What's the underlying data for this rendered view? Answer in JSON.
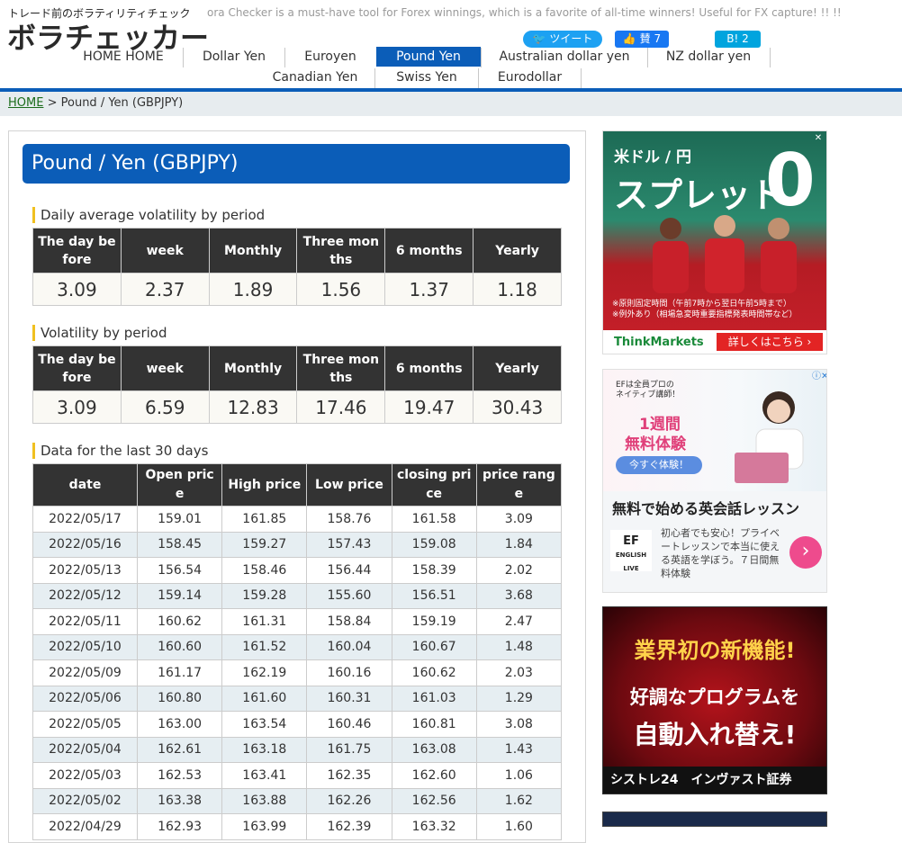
{
  "header": {
    "logo_sub": "トレード前のボラティリティチェック",
    "logo_main": "ボラチェッカー",
    "tagline": "ora Checker is a must-have tool for Forex winnings, which is a favorite of all-time winners! Useful for FX capture! !! !!",
    "share": {
      "tweet": "ツイート",
      "fb": "賛 7",
      "hatena": "B! 2"
    }
  },
  "nav": {
    "items": [
      {
        "label": "HOME HOME"
      },
      {
        "label": "Dollar Yen"
      },
      {
        "label": "Euroyen"
      },
      {
        "label": "Pound Yen"
      },
      {
        "label": "Australian dollar yen"
      },
      {
        "label": "NZ dollar yen"
      },
      {
        "label": "Canadian Yen"
      },
      {
        "label": "Swiss Yen"
      },
      {
        "label": "Eurodollar"
      }
    ]
  },
  "breadcrumb": {
    "home": "HOME",
    "sep": " > ",
    "current": "Pound / Yen (GBPJPY)"
  },
  "page": {
    "title": "Pound / Yen (GBPJPY)"
  },
  "avg_section": {
    "title": "Daily average volatility by period",
    "headers": [
      "The day before",
      "week",
      "Monthly",
      "Three months",
      "6 months",
      "Yearly"
    ],
    "values": [
      "3.09",
      "2.37",
      "1.89",
      "1.56",
      "1.37",
      "1.18"
    ]
  },
  "vol_section": {
    "title": "Volatility by period",
    "headers": [
      "The day before",
      "week",
      "Monthly",
      "Three months",
      "6 months",
      "Yearly"
    ],
    "values": [
      "3.09",
      "6.59",
      "12.83",
      "17.46",
      "19.47",
      "30.43"
    ]
  },
  "data_section": {
    "title": "Data for the last 30 days",
    "headers": [
      "date",
      "Open price",
      "High price",
      "Low price",
      "closing price",
      "price range"
    ],
    "rows": [
      [
        "2022/05/17",
        "159.01",
        "161.85",
        "158.76",
        "161.58",
        "3.09"
      ],
      [
        "2022/05/16",
        "158.45",
        "159.27",
        "157.43",
        "159.08",
        "1.84"
      ],
      [
        "2022/05/13",
        "156.54",
        "158.46",
        "156.44",
        "158.39",
        "2.02"
      ],
      [
        "2022/05/12",
        "159.14",
        "159.28",
        "155.60",
        "156.51",
        "3.68"
      ],
      [
        "2022/05/11",
        "160.62",
        "161.31",
        "158.84",
        "159.19",
        "2.47"
      ],
      [
        "2022/05/10",
        "160.60",
        "161.52",
        "160.04",
        "160.67",
        "1.48"
      ],
      [
        "2022/05/09",
        "161.17",
        "162.19",
        "160.16",
        "160.62",
        "2.03"
      ],
      [
        "2022/05/06",
        "160.80",
        "161.60",
        "160.31",
        "161.03",
        "1.29"
      ],
      [
        "2022/05/05",
        "163.00",
        "163.54",
        "160.46",
        "160.81",
        "3.08"
      ],
      [
        "2022/05/04",
        "162.61",
        "163.18",
        "161.75",
        "163.08",
        "1.43"
      ],
      [
        "2022/05/03",
        "162.53",
        "163.41",
        "162.35",
        "162.60",
        "1.06"
      ],
      [
        "2022/05/02",
        "163.38",
        "163.88",
        "162.26",
        "162.56",
        "1.62"
      ],
      [
        "2022/04/29",
        "162.93",
        "163.99",
        "162.39",
        "163.32",
        "1.60"
      ]
    ]
  },
  "ads": {
    "thinkmarkets": {
      "line1": "米ドル / 円",
      "line2": "スプレッド",
      "zero": "0",
      "note1": "※原則固定時間（午前7時から翌日午前5時まで）",
      "note2": "※例外あり（相場急変時重要指標発表時間帯など）",
      "brand": "ThinkMarkets",
      "cta": "詳しくはこちら ›"
    },
    "ef": {
      "small1": "EFは全員プロの",
      "small2": "ネイティブ講師！",
      "big1": "1週間",
      "big2": "無料体験",
      "btn": "今すぐ体験！",
      "headline": "無料で始める英会話レッスン",
      "logo": "EF",
      "logo_sub": "ENGLISH LIVE",
      "body": "初心者でも安心！プライベートレッスンで本当に使える英語を学ぼう。７日間無料体験",
      "arrow": "›"
    },
    "systre": {
      "t1": "業界初の新機能!",
      "t2": "好調なプログラムを",
      "t3": "自動入れ替え!",
      "foot": "シストレ24　インヴァスト証券"
    }
  }
}
